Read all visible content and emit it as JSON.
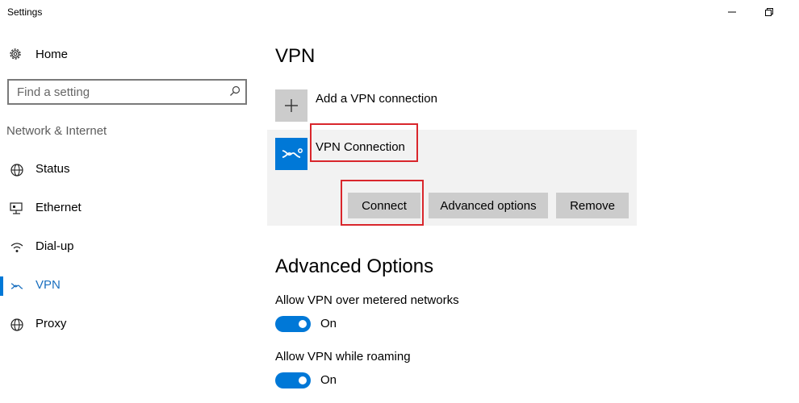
{
  "window": {
    "title": "Settings",
    "minimize_icon": "minimize-icon",
    "restore_icon": "restore-icon"
  },
  "sidebar": {
    "home_label": "Home",
    "search_placeholder": "Find a setting",
    "section_label": "Network & Internet",
    "items": [
      {
        "label": "Status",
        "icon": "globe-status-icon",
        "active": false
      },
      {
        "label": "Ethernet",
        "icon": "ethernet-icon",
        "active": false
      },
      {
        "label": "Dial-up",
        "icon": "dialup-icon",
        "active": false
      },
      {
        "label": "VPN",
        "icon": "vpn-icon",
        "active": true
      },
      {
        "label": "Proxy",
        "icon": "globe-proxy-icon",
        "active": false
      }
    ]
  },
  "main": {
    "title": "VPN",
    "add_label": "Add a VPN connection",
    "connection": {
      "name": "VPN Connection",
      "connect_label": "Connect",
      "advanced_label": "Advanced options",
      "remove_label": "Remove"
    },
    "advanced": {
      "title": "Advanced Options",
      "options": [
        {
          "label": "Allow VPN over metered networks",
          "state": "On"
        },
        {
          "label": "Allow VPN while roaming",
          "state": "On"
        }
      ]
    }
  },
  "colors": {
    "accent": "#0078d7",
    "highlight": "#d9262c",
    "card_bg": "#f2f2f2",
    "button_bg": "#cccccc"
  }
}
